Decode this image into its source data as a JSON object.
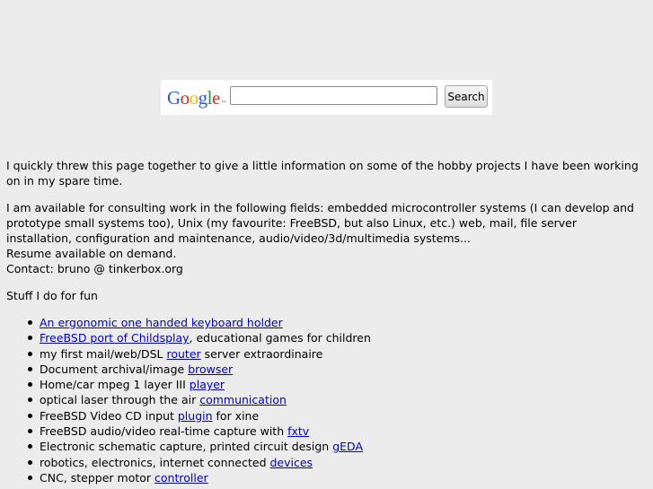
{
  "search": {
    "logo_text": "Google",
    "logo_tm": "™",
    "input_value": "",
    "button_label": "Search"
  },
  "intro": "I quickly threw this page together to give a little information on some of the hobby projects I have been working on in my spare time.",
  "consulting": "I am available for consulting work in the following fields: embedded microcontroller systems (I can develop and prototype small systems too), Unix (my favourite: FreeBSD, but also Linux, etc.) web, mail, file server installation, configuration and maintenance, audio/video/3d/multimedia systems...",
  "resume": "Resume available on demand.",
  "contact": "Contact: bruno @ tinkerbox.org",
  "stuff_heading": "Stuff I do for fun",
  "items": [
    {
      "before": "",
      "link": "An ergonomic one handed keyboard holder",
      "after": ""
    },
    {
      "before": "",
      "link": "FreeBSD port of Childsplay",
      "after": ", educational games for children"
    },
    {
      "before": "my first mail/web/DSL ",
      "link": "router",
      "after": " server extraordinaire"
    },
    {
      "before": "Document archival/image ",
      "link": "browser",
      "after": ""
    },
    {
      "before": "Home/car mpeg 1 layer III ",
      "link": "player",
      "after": ""
    },
    {
      "before": "optical laser through the air ",
      "link": "communication",
      "after": ""
    },
    {
      "before": "FreeBSD Video CD input ",
      "link": "plugin",
      "after": " for xine"
    },
    {
      "before": "FreeBSD audio/video real-time capture with ",
      "link": "fxtv",
      "after": ""
    },
    {
      "before": "Electronic schematic capture, printed circuit design ",
      "link": "gEDA",
      "after": ""
    },
    {
      "before": "robotics, electronics, internet connected ",
      "link": "devices",
      "after": ""
    },
    {
      "before": "CNC, stepper motor ",
      "link": "controller",
      "after": ""
    }
  ]
}
